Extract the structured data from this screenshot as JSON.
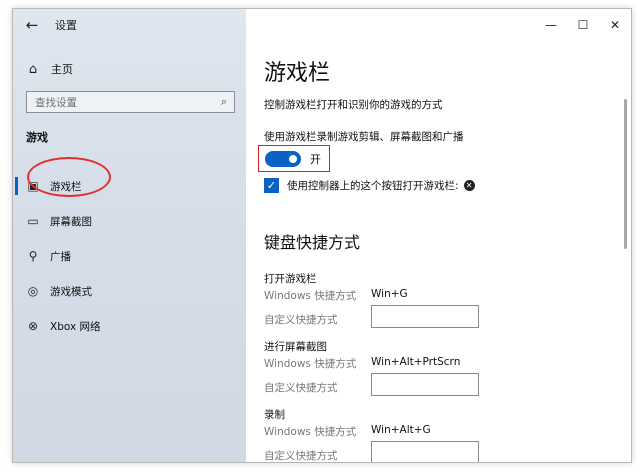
{
  "window": {
    "title": "设置",
    "controls": [
      "—",
      "☐",
      "✕"
    ]
  },
  "sidebar": {
    "home_label": "主页",
    "search_placeholder": "查找设置",
    "section_label": "游戏",
    "items": [
      {
        "label": "游戏栏",
        "icon": "game-bar-icon",
        "selected": true
      },
      {
        "label": "屏幕截图",
        "icon": "screenshot-icon",
        "selected": false
      },
      {
        "label": "广播",
        "icon": "broadcast-icon",
        "selected": false
      },
      {
        "label": "游戏模式",
        "icon": "game-mode-icon",
        "selected": false
      },
      {
        "label": "Xbox 网络",
        "icon": "xbox-icon",
        "selected": false
      }
    ]
  },
  "main": {
    "title": "游戏栏",
    "description": "控制游戏栏打开和识别你的游戏的方式",
    "record_label": "使用游戏栏录制游戏剪辑、屏幕截图和广播",
    "toggle_state": "开",
    "checkbox_label": "使用控制器上的这个按钮打开游戏栏:",
    "keyboard_title": "键盘快捷方式",
    "shortcuts": [
      {
        "group": "打开游戏栏",
        "windows_label": "Windows 快捷方式",
        "windows_value": "Win+G",
        "custom_label": "自定义快捷方式"
      },
      {
        "group": "进行屏幕截图",
        "windows_label": "Windows 快捷方式",
        "windows_value": "Win+Alt+PrtScrn",
        "custom_label": "自定义快捷方式"
      },
      {
        "group": "录制",
        "windows_label": "Windows 快捷方式",
        "windows_value": "Win+Alt+G",
        "custom_label": "自定义快捷方式"
      }
    ]
  },
  "colors": {
    "accent": "#0a62c2",
    "highlight_red": "#e02020"
  }
}
